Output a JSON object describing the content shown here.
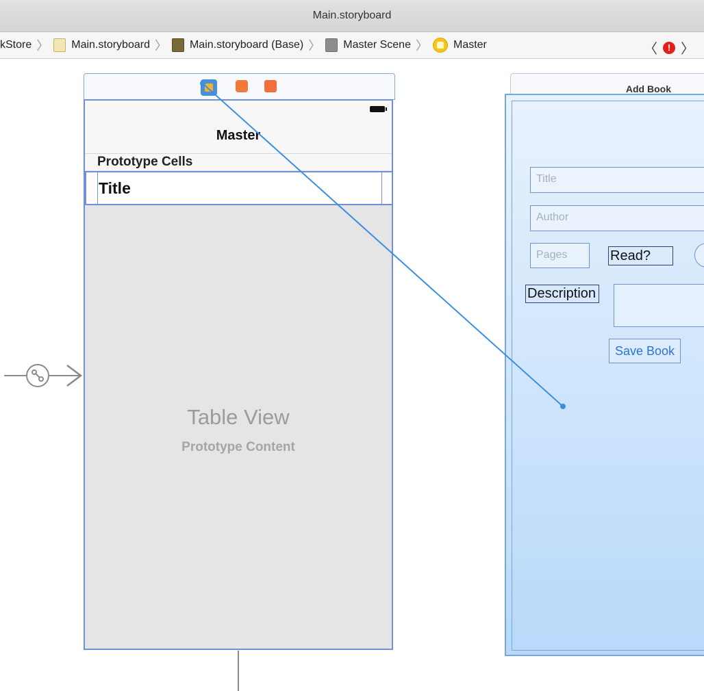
{
  "window": {
    "title": "Main.storyboard"
  },
  "jumpbar": {
    "items": [
      {
        "label": "kStore",
        "icon": ""
      },
      {
        "label": "Main.storyboard",
        "icon": "storyboard-file-icon"
      },
      {
        "label": "Main.storyboard (Base)",
        "icon": "base-localization-icon"
      },
      {
        "label": "Master Scene",
        "icon": "scene-icon"
      },
      {
        "label": "Master",
        "icon": "view-controller-icon"
      }
    ],
    "back_glyph": "〈",
    "forward_glyph": "〉",
    "error_glyph": "!"
  },
  "master_scene": {
    "nav_title": "Master",
    "section_header": "Prototype Cells",
    "cell_label": "Title",
    "table_view_title": "Table View",
    "table_view_subtitle": "Prototype Content"
  },
  "add_book_scene": {
    "title": "Add Book",
    "title_placeholder": "Title",
    "author_placeholder": "Author",
    "pages_placeholder": "Pages",
    "read_label": "Read?",
    "description_label": "Description",
    "save_button": "Save Book"
  },
  "colors": {
    "selection_blue": "#6f8fd6",
    "connection_line": "#3a8fe0",
    "button_text": "#2a72e0",
    "error_red": "#e0201b"
  }
}
